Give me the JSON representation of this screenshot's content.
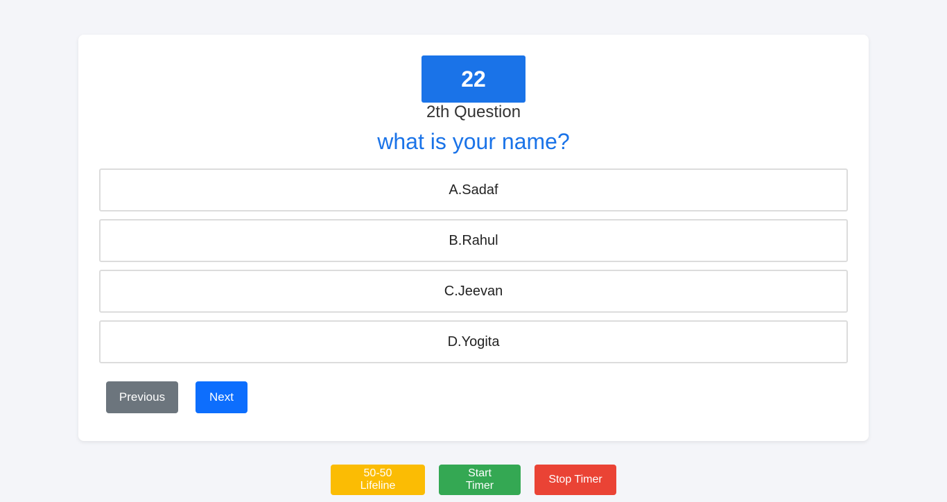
{
  "quiz": {
    "timer_value": "22",
    "question_number": "2th Question",
    "question_text": "what is your name?",
    "options": [
      {
        "label": "A.Sadaf"
      },
      {
        "label": "B.Rahul"
      },
      {
        "label": "C.Jeevan"
      },
      {
        "label": "D.Yogita"
      }
    ]
  },
  "navigation": {
    "previous_label": "Previous",
    "next_label": "Next"
  },
  "tools": {
    "lifeline_label": "50-50 Lifeline",
    "start_timer_label": "Start Timer",
    "stop_timer_label": "Stop Timer"
  },
  "colors": {
    "accent": "#1a73e8",
    "previous": "#6c757d",
    "next": "#0d6efd",
    "lifeline": "#fbbc04",
    "start": "#34a853",
    "stop": "#ea4335"
  }
}
